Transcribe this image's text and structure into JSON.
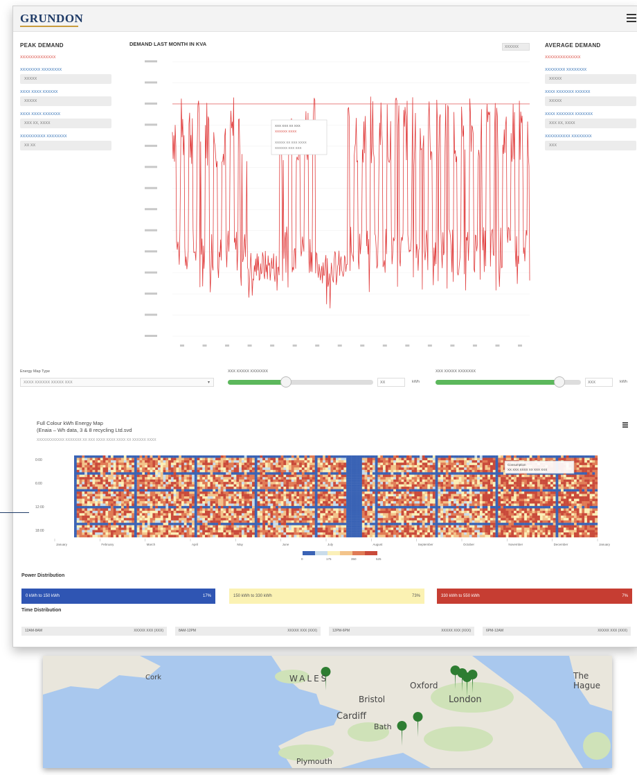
{
  "brand": {
    "logo": "GRUNDON"
  },
  "left_panel": {
    "title": "PEAK DEMAND",
    "subtitle": "XXXXXXXXXXXXXX",
    "fields": [
      {
        "label": "XXXXXXXX XXXXXXXX",
        "value": "XXXXX"
      },
      {
        "label": "XXXX XXXX XXXXXX",
        "value": "XXXXX"
      },
      {
        "label": "XXXX XXXX XXXXXXX",
        "value": "XXX XX, XXXX"
      },
      {
        "label": "XXXXXXXXXX XXXXXXXX",
        "value": "XX XX"
      }
    ]
  },
  "right_panel": {
    "title": "AVERAGE DEMAND",
    "subtitle": "XXXXXXXXXXXXXX",
    "fields": [
      {
        "label": "XXXXXXXX XXXXXXXX",
        "value": "XXXXX"
      },
      {
        "label": "XXXX XXXXXXX XXXXXX",
        "value": "XXXXX"
      },
      {
        "label": "XXXX XXXXXXX XXXXXXX",
        "value": "XXX XX, XXXX"
      },
      {
        "label": "XXXXXXXXXX XXXXXXXX",
        "value": "XXX"
      }
    ]
  },
  "demand_chart": {
    "title": "DEMAND LAST MONTH IN KVA",
    "selector": "XXXXXX",
    "tooltip": {
      "line1": "XXX XXX XX XXX",
      "line2": "XXXXXX XXXX",
      "line3": "XXXXX XX XXX XXXX",
      "line4": "XXXXXX XXX XXX"
    }
  },
  "chart_data": {
    "type": "line",
    "title": "DEMAND LAST MONTH IN KVA",
    "x_tick_count": 16,
    "ylim": [
      0,
      13
    ],
    "threshold": 11,
    "series_color": "#e03b3b"
  },
  "controls": {
    "dropdown_label": "Energy Map Type",
    "dropdown_value": "XXXX XXXXXX XXXXX XXX",
    "slider1_label": "XXX XXXXX XXXXXXX",
    "slider1_value": "XX",
    "slider1_fill": 0.4,
    "slider2_label": "XXX XXXXX XXXXXXX",
    "slider2_value": "XXX",
    "slider2_fill": 0.85,
    "unit": "kWh"
  },
  "heatmap": {
    "title_line1": "Full Colour kWh Energy Map",
    "title_line2": "(Enaiа – Wh data, 3 & 8 recycling Ltd.svd",
    "subtitle": "XXXXXXXXXXXX XXXXXXX XX XXX XXXX XXXX XXXX XX XXXXXX XXXX",
    "y_labels": [
      "0:00",
      "6:00",
      "12:00",
      "18:00"
    ],
    "months": [
      "January",
      "February",
      "March",
      "April",
      "May",
      "June",
      "July",
      "August",
      "September",
      "October",
      "November",
      "December",
      "January"
    ],
    "legend": [
      "0",
      "175",
      "350",
      "525"
    ],
    "tooltip": {
      "line1": "Consumption",
      "line2": "XX XXX XXXX XX XXX XXX"
    }
  },
  "power_distribution": {
    "title": "Power Distribution",
    "bars": [
      {
        "range": "0 kWh to 150 kWh",
        "pct": "17%",
        "color": "#2f55b3"
      },
      {
        "range": "150 kWh to 330 kWh",
        "pct": "73%",
        "color": "#fbf2b3"
      },
      {
        "range": "330 kWh to 550 kWh",
        "pct": "7%",
        "color": "#c63d32"
      }
    ]
  },
  "time_distribution": {
    "title": "Time Distribution",
    "cells": [
      {
        "label": "12AM-8AM",
        "value": "XXXXX XXX (XXX)"
      },
      {
        "label": "8AM-12PM",
        "value": "XXXXX XXX (XXX)"
      },
      {
        "label": "12PM-6PM",
        "value": "XXXXX XXX (XXX)"
      },
      {
        "label": "6PM-12AM",
        "value": "XXXXX XXX (XXX)"
      }
    ]
  },
  "map": {
    "labels": [
      "Cork",
      "WALES",
      "Oxford",
      "London",
      "Bristol",
      "Cardiff",
      "Bath",
      "Plymouth",
      "The Hague"
    ]
  }
}
